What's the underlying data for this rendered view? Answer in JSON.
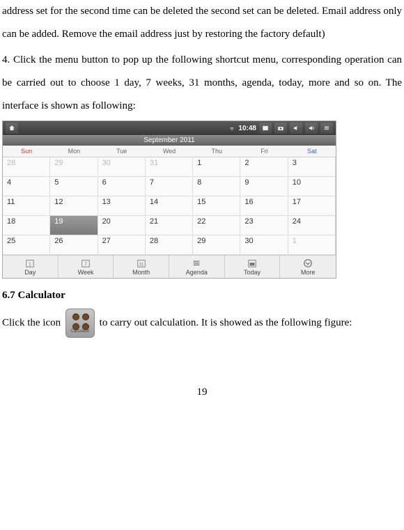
{
  "paragraph1": "address set for the second time can be deleted the second set can be deleted. Email address only can be added. Remove the email address just by restoring the factory default)",
  "paragraph2": "4. Click the menu button to pop up the following shortcut menu, corresponding operation can be carried out to choose 1 day, 7 weeks, 31 months, agenda, today, more and so on. The interface is shown as following:",
  "calendar": {
    "time": "10:48",
    "title": "September 2011",
    "dow": [
      "Sun",
      "Mon",
      "Tue",
      "Wed",
      "Thu",
      "Fri",
      "Sat"
    ],
    "rows": [
      [
        {
          "d": "28",
          "g": true
        },
        {
          "d": "29",
          "g": true
        },
        {
          "d": "30",
          "g": true
        },
        {
          "d": "31",
          "g": true
        },
        {
          "d": "1"
        },
        {
          "d": "2"
        },
        {
          "d": "3"
        }
      ],
      [
        {
          "d": "4"
        },
        {
          "d": "5"
        },
        {
          "d": "6"
        },
        {
          "d": "7"
        },
        {
          "d": "8"
        },
        {
          "d": "9"
        },
        {
          "d": "10"
        }
      ],
      [
        {
          "d": "11"
        },
        {
          "d": "12"
        },
        {
          "d": "13"
        },
        {
          "d": "14"
        },
        {
          "d": "15"
        },
        {
          "d": "16"
        },
        {
          "d": "17"
        }
      ],
      [
        {
          "d": "18"
        },
        {
          "d": "19",
          "sel": true
        },
        {
          "d": "20"
        },
        {
          "d": "21"
        },
        {
          "d": "22"
        },
        {
          "d": "23"
        },
        {
          "d": "24"
        }
      ],
      [
        {
          "d": "25"
        },
        {
          "d": "26"
        },
        {
          "d": "27"
        },
        {
          "d": "28"
        },
        {
          "d": "29"
        },
        {
          "d": "30"
        },
        {
          "d": "1",
          "g": true
        }
      ]
    ],
    "tabs": [
      "Day",
      "Week",
      "Month",
      "Agenda",
      "Today",
      "More"
    ]
  },
  "heading67": "6.7 Calculator",
  "calc_pre": "Click  the  icon ",
  "calc_post": "  to  carry  out  calculation.  It  is  showed  as  the  following figure:",
  "calc_icon_label": "Calculator",
  "page_number": "19"
}
